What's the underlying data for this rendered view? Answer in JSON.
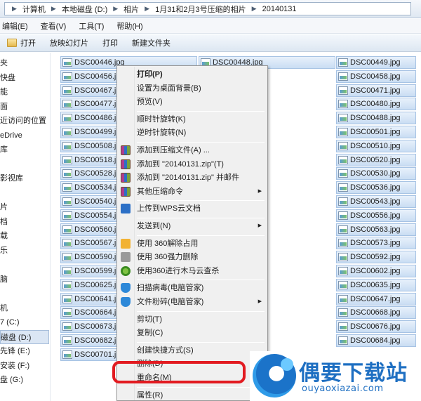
{
  "address": {
    "crumbs": [
      "计算机",
      "本地磁盘 (D:)",
      "相片",
      "1月31和2月3号压缩的相片",
      "20140131"
    ]
  },
  "menubar": [
    "编辑(E)",
    "查看(V)",
    "工具(T)",
    "帮助(H)"
  ],
  "toolbar": [
    "打开",
    "放映幻灯片",
    "打印",
    "新建文件夹"
  ],
  "nav": {
    "items": [
      "夹",
      "快盘",
      "能",
      "面",
      "近访问的位置",
      "eDrive",
      "库",
      "",
      "影视库",
      "",
      "片",
      "档",
      "载",
      "乐",
      "",
      "脑",
      "",
      "机",
      "7 (C:)",
      "磁盘 (D:)",
      "先锋 (E:)",
      "安装 (F:)",
      "盘 (G:)"
    ],
    "selected_index": 19
  },
  "files": {
    "col1": [
      "DSC00446.jpg",
      "DSC00456.jpg",
      "DSC00467.jpg",
      "DSC00477.jpg",
      "DSC00486.jpg",
      "DSC00499.jpg",
      "DSC00508.jpg",
      "DSC00518.jpg",
      "DSC00528.jpg",
      "DSC00534.jpg",
      "DSC00540.jpg",
      "DSC00554.jpg",
      "DSC00560.jpg",
      "DSC00567.jpg",
      "DSC00590.jpg",
      "DSC00599.jpg",
      "DSC00625.jpg",
      "DSC00641.jpg",
      "DSC00664.jpg",
      "DSC00673.jpg",
      "DSC00682.jpg",
      "DSC00701.jpg"
    ],
    "col2": [
      "DSC00448.jpg"
    ],
    "col3": [
      "DSC00449.jpg",
      "DSC00458.jpg",
      "DSC00471.jpg",
      "DSC00480.jpg",
      "DSC00488.jpg",
      "DSC00501.jpg",
      "DSC00510.jpg",
      "DSC00520.jpg",
      "DSC00530.jpg",
      "DSC00536.jpg",
      "DSC00543.jpg",
      "DSC00556.jpg",
      "DSC00563.jpg",
      "DSC00573.jpg",
      "DSC00592.jpg",
      "DSC00602.jpg",
      "DSC00635.jpg",
      "DSC00647.jpg",
      "DSC00668.jpg",
      "DSC00676.jpg",
      "DSC00684.jpg"
    ]
  },
  "context_menu": {
    "items": [
      {
        "label": "打印(P)",
        "bold": true
      },
      {
        "label": "设置为桌面背景(B)"
      },
      {
        "label": "预览(V)"
      },
      {
        "sep": true
      },
      {
        "label": "顺时针旋转(K)"
      },
      {
        "label": "逆时针旋转(N)"
      },
      {
        "sep": true
      },
      {
        "label": "添加到压缩文件(A) ...",
        "icon": "zip-icon"
      },
      {
        "label": "添加到 \"20140131.zip\"(T)",
        "icon": "zip-icon"
      },
      {
        "label": "添加到 \"20140131.zip\" 并邮件",
        "icon": "zip-icon"
      },
      {
        "label": "其他压缩命令",
        "icon": "zip-icon",
        "submenu": true
      },
      {
        "sep": true
      },
      {
        "label": "上传到WPS云文档",
        "icon": "wps-cloud-icon"
      },
      {
        "sep": true
      },
      {
        "label": "发送到(N)",
        "submenu": true
      },
      {
        "sep": true
      },
      {
        "label": "使用 360解除占用",
        "icon": "360-unlock-icon"
      },
      {
        "label": "使用 360强力删除",
        "icon": "360-shred-icon"
      },
      {
        "label": "使用360进行木马云查杀",
        "icon": "360-scan-icon"
      },
      {
        "sep": true
      },
      {
        "label": "扫描病毒(电脑管家)",
        "icon": "shield-icon"
      },
      {
        "label": "文件粉碎(电脑管家)",
        "icon": "shield-icon",
        "submenu": true
      },
      {
        "sep": true
      },
      {
        "label": "剪切(T)"
      },
      {
        "label": "复制(C)"
      },
      {
        "sep": true
      },
      {
        "label": "创建快捷方式(S)"
      },
      {
        "label": "删除(D)"
      },
      {
        "label": "重命名(M)",
        "highlighted": true
      },
      {
        "sep": true
      },
      {
        "label": "属性(R)"
      }
    ]
  },
  "watermark": {
    "title": "偶要下载站",
    "url": "ouyaoxiazai.com"
  },
  "colors": {
    "highlight_ring": "#e21b21",
    "selection_fill": "#c9ddf3",
    "brand_blue": "#1e6fc2"
  }
}
